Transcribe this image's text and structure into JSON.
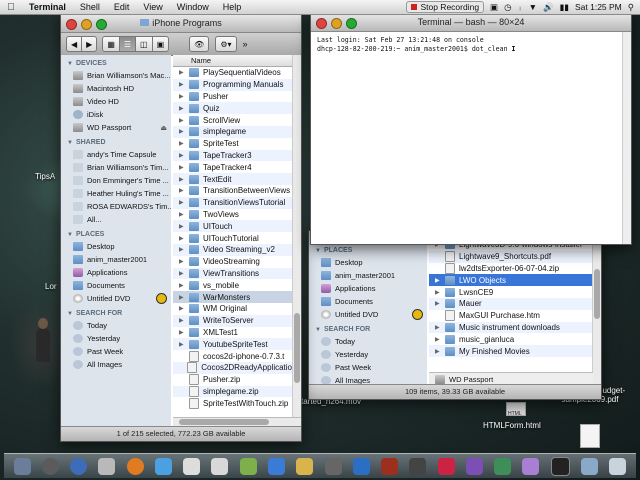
{
  "menubar": {
    "app": "Terminal",
    "items": [
      "Shell",
      "Edit",
      "View",
      "Window",
      "Help"
    ],
    "recording": "Stop Recording",
    "clock": "Sat 1:25 PM"
  },
  "finder_left": {
    "title": "iPhone Programs",
    "status": "1 of 215 selected, 772.23 GB available",
    "column_header": "Name",
    "sidebar": {
      "devices_header": "DEVICES",
      "devices": [
        "Brian Williamson's Mac...",
        "Macintosh HD",
        "Video HD",
        "iDisk",
        "WD Passport"
      ],
      "shared_header": "SHARED",
      "shared": [
        "andy's Time Capsule",
        "Brian Williamson's Tim...",
        "Don Emminger's Time ...",
        "Heather Huling's Time ...",
        "ROSA EDWARDS's Tim...",
        "All..."
      ],
      "places_header": "PLACES",
      "places": [
        "Desktop",
        "anim_master2001",
        "Applications",
        "Documents",
        "Untitled DVD"
      ],
      "search_header": "SEARCH FOR",
      "search": [
        "Today",
        "Yesterday",
        "Past Week",
        "All Images"
      ]
    },
    "rows": [
      "PlaySequentialVideos",
      "Programming Manuals",
      "Pusher",
      "Quiz",
      "ScrollView",
      "simplegame",
      "SpriteTest",
      "TapeTracker3",
      "TapeTracker4",
      "TextEdit",
      "TransitionBetweenViews",
      "TransitionViewsTutorial",
      "TwoViews",
      "UITouch",
      "UITouchTutorial",
      "Video Streaming_v2",
      "VideoStreaming",
      "ViewTransitions",
      "vs_mobile",
      "WarMonsters",
      "WM Original",
      "WriteToServer",
      "XMLTest1",
      "YoutubeSpriteTest",
      "cocos2d-iphone-0.7.3.t",
      "Cocos2DReadyApplicatio",
      "Pusher.zip",
      "simplegame.zip",
      "SpriteTestWithTouch.zip"
    ]
  },
  "terminal": {
    "title": "Terminal — bash — 80×24",
    "line1": "Last login: Sat Feb 27 13:21:48 on console",
    "line2": "dhcp-128-82-200-219:~ anim_master2001$ dot_clean "
  },
  "finder_right": {
    "status": "109 items, 39.33 GB available",
    "path": "WD Passport",
    "sidebar": {
      "places_header": "PLACES",
      "places": [
        "Desktop",
        "anim_master2001",
        "Applications",
        "Documents",
        "Untitled DVD"
      ],
      "search_header": "SEARCH FOR",
      "search": [
        "Today",
        "Yesterday",
        "Past Week",
        "All Images"
      ]
    },
    "rows": [
      "Lightwave3D-9.6-windows-installer",
      "Lightwave9_Shortcuts.pdf",
      "lw2dtsExporter-06-07-04.zip",
      "LWO Objects",
      "LwsnCE9",
      "Mauer",
      "MaxGUI Purchase.htm",
      "Music instrument downloads",
      "music_gianluca",
      "My Finished Movies"
    ]
  },
  "desktop": {
    "icon1_label": "sag-ultralowbudget-sample2009.pdf",
    "icon2_label": "HTMLForm.html",
    "partial1": "TipsA",
    "partial2": "Lor",
    "partial3": "tarted_h264.mov",
    "partial4": "HTML"
  }
}
